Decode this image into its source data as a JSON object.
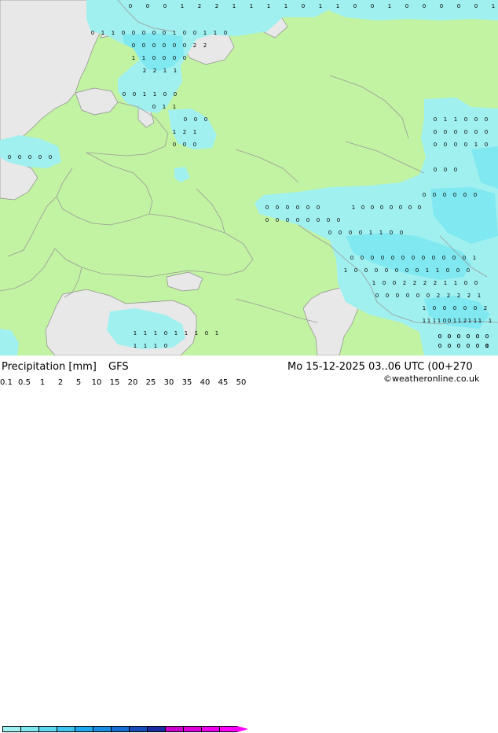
{
  "title": "Precipitation [mm]",
  "model": "GFS",
  "valid_time": "Mo 15-12-2025 03..06 UTC (00+270",
  "credit": "©weatheronline.co.uk",
  "legend": {
    "ticks": [
      "0.1",
      "0.5",
      "1",
      "2",
      "5",
      "10",
      "15",
      "20",
      "25",
      "30",
      "35",
      "40",
      "45",
      "50"
    ],
    "colors": [
      "#a0f0f0",
      "#80e8f0",
      "#60d8f0",
      "#40c4f0",
      "#20a8f0",
      "#1c8ce0",
      "#1a6ed0",
      "#1a4cb8",
      "#1a2ca0",
      "#cc00cc",
      "#dd00dd",
      "#ee00ee",
      "#ff00ff",
      "#ff00ff"
    ]
  },
  "colors": {
    "land": "#c2f3a2",
    "sea": "#e8e8e8",
    "precip_light": "#a0f0f0",
    "precip_medium": "#80e8f0",
    "border": "#9a9a9a"
  },
  "values": [
    "0",
    "0",
    "0",
    "1",
    "2",
    "2",
    "1",
    "1",
    "1",
    "1",
    "0",
    "1",
    "1",
    "0",
    "0",
    "1",
    "0",
    "0",
    "0",
    "0",
    "0",
    "1",
    "0",
    "1",
    "1",
    "0",
    "0",
    "0",
    "0",
    "0",
    "1",
    "0",
    "0",
    "1",
    "1",
    "0",
    "0",
    "0",
    "0",
    "0",
    "0",
    "0",
    "2",
    "2",
    "1",
    "1",
    "0",
    "0",
    "0",
    "0",
    "2",
    "2",
    "1",
    "1",
    "0",
    "0",
    "1",
    "1",
    "0",
    "0",
    "0",
    "1",
    "1",
    "0",
    "0",
    "0",
    "0",
    "0",
    "0",
    "0",
    "0",
    "1",
    "2",
    "1",
    "0",
    "0",
    "0",
    "0",
    "0",
    "0",
    "0",
    "0",
    "0",
    "0",
    "0",
    "0",
    "0",
    "0",
    "0",
    "0",
    "0",
    "0",
    "0",
    "0",
    "0",
    "0",
    "0",
    "0",
    "0",
    "0",
    "1",
    "0",
    "0",
    "0",
    "0",
    "0",
    "0",
    "0",
    "0",
    "0",
    "0",
    "0",
    "1",
    "1",
    "0",
    "0",
    "0",
    "1",
    "1",
    "0",
    "0",
    "0",
    "0",
    "0",
    "0",
    "0",
    "0",
    "0",
    "0",
    "0",
    "0",
    "0",
    "1",
    "0",
    "0",
    "0",
    "0",
    "0",
    "0",
    "0",
    "0",
    "0",
    "0",
    "0",
    "0",
    "0",
    "1",
    "1",
    "0",
    "0",
    "0",
    "0",
    "0",
    "0",
    "0",
    "1",
    "1",
    "0",
    "0",
    "0",
    "1",
    "0",
    "0",
    "2",
    "2",
    "2",
    "2",
    "1",
    "1",
    "0",
    "0",
    "0",
    "0",
    "0",
    "0",
    "0",
    "0",
    "2",
    "2",
    "2",
    "2",
    "1",
    "1",
    "0",
    "0",
    "0",
    "0",
    "0",
    "2",
    "1",
    "1",
    "0",
    "1",
    "1",
    "1",
    "1",
    "1",
    "1",
    "1",
    "0",
    "1",
    "1",
    "1",
    "0",
    "1",
    "1",
    "1",
    "1",
    "0",
    "1",
    "1",
    "0",
    "1",
    "2",
    "1",
    "1",
    "0",
    "0",
    "0",
    "0",
    "0",
    "0",
    "0",
    "0",
    "0",
    "0",
    "0",
    "0",
    "0",
    "0",
    "0",
    "0",
    "0",
    "0",
    "0",
    "0",
    "0",
    "0",
    "0",
    "0",
    "0",
    "0",
    "0",
    "0",
    "0"
  ]
}
